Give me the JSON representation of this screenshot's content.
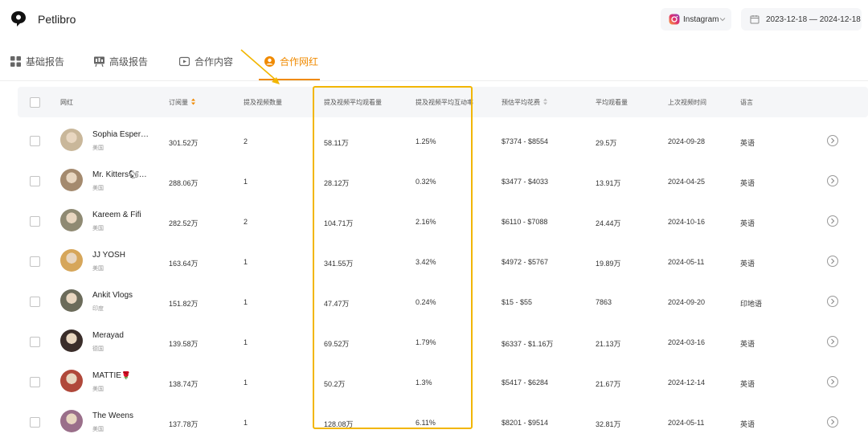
{
  "app": {
    "name": "Petlibro"
  },
  "header": {
    "platform": "Instagram",
    "date_range": "2023-12-18 — 2024-12-18"
  },
  "tabs": [
    {
      "label": "基础报告",
      "active": false
    },
    {
      "label": "高级报告",
      "active": false
    },
    {
      "label": "合作内容",
      "active": false
    },
    {
      "label": "合作网红",
      "active": true
    }
  ],
  "colors": {
    "accent": "#f08a00",
    "highlight": "#f2b600"
  },
  "table": {
    "columns": [
      "网红",
      "订阅量",
      "提及视频数量",
      "提及视频平均观看量",
      "提及视频平均互动率",
      "预估平均花费",
      "平均观看量",
      "上次视频时间",
      "语言"
    ],
    "rows": [
      {
        "name": "Sophia Esper…",
        "country": "美国",
        "subs": "301.52万",
        "videos": "2",
        "avg_views": "58.11万",
        "avg_eng": "1.25%",
        "cost": "$7374 - $8554",
        "views": "29.5万",
        "last": "2024-09-28",
        "lang": "英语"
      },
      {
        "name": "Mr. Kitters🐿…",
        "country": "美国",
        "subs": "288.06万",
        "videos": "1",
        "avg_views": "28.12万",
        "avg_eng": "0.32%",
        "cost": "$3477 - $4033",
        "views": "13.91万",
        "last": "2024-04-25",
        "lang": "英语"
      },
      {
        "name": "Kareem & Fifi",
        "country": "美国",
        "subs": "282.52万",
        "videos": "2",
        "avg_views": "104.71万",
        "avg_eng": "2.16%",
        "cost": "$6110 - $7088",
        "views": "24.44万",
        "last": "2024-10-16",
        "lang": "英语"
      },
      {
        "name": "JJ YOSH",
        "country": "美国",
        "subs": "163.64万",
        "videos": "1",
        "avg_views": "341.55万",
        "avg_eng": "3.42%",
        "cost": "$4972 - $5767",
        "views": "19.89万",
        "last": "2024-05-11",
        "lang": "英语"
      },
      {
        "name": "Ankit Vlogs",
        "country": "印度",
        "subs": "151.82万",
        "videos": "1",
        "avg_views": "47.47万",
        "avg_eng": "0.24%",
        "cost": "$15 - $55",
        "views": "7863",
        "last": "2024-09-20",
        "lang": "印地语"
      },
      {
        "name": "Merayad",
        "country": "德国",
        "subs": "139.58万",
        "videos": "1",
        "avg_views": "69.52万",
        "avg_eng": "1.79%",
        "cost": "$6337 - $1.16万",
        "views": "21.13万",
        "last": "2024-03-16",
        "lang": "英语"
      },
      {
        "name": "MATTIE🌹",
        "country": "美国",
        "subs": "138.74万",
        "videos": "1",
        "avg_views": "50.2万",
        "avg_eng": "1.3%",
        "cost": "$5417 - $6284",
        "views": "21.67万",
        "last": "2024-12-14",
        "lang": "英语"
      },
      {
        "name": "The Weens",
        "country": "美国",
        "subs": "137.78万",
        "videos": "1",
        "avg_views": "128.08万",
        "avg_eng": "6.11%",
        "cost": "$8201 - $9514",
        "views": "32.81万",
        "last": "2024-05-11",
        "lang": "英语"
      }
    ]
  }
}
